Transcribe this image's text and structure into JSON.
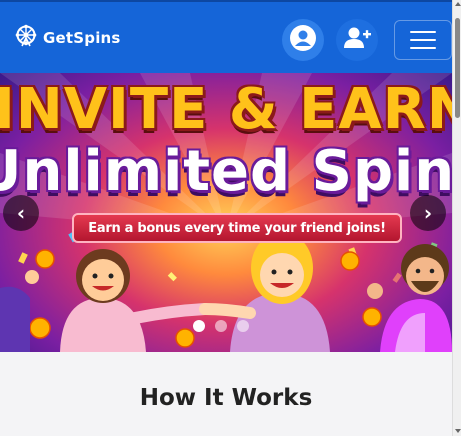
{
  "navbar": {
    "brand_name": "GetSpins",
    "brand_icon": "ferris-wheel-icon",
    "login_icon": "user-circle-icon",
    "register_icon": "user-plus-icon",
    "menu_icon": "hamburger-menu-icon",
    "color": "#1565d8"
  },
  "banner": {
    "headline_line1": "INVITE & EARN",
    "headline_line2": "Unlimited Spins",
    "ribbon_text": "Earn a bonus every time your friend joins!",
    "prev_label": "‹",
    "next_label": "›",
    "slide_count": 3,
    "active_slide": 1
  },
  "content": {
    "section_title": "How It Works"
  }
}
